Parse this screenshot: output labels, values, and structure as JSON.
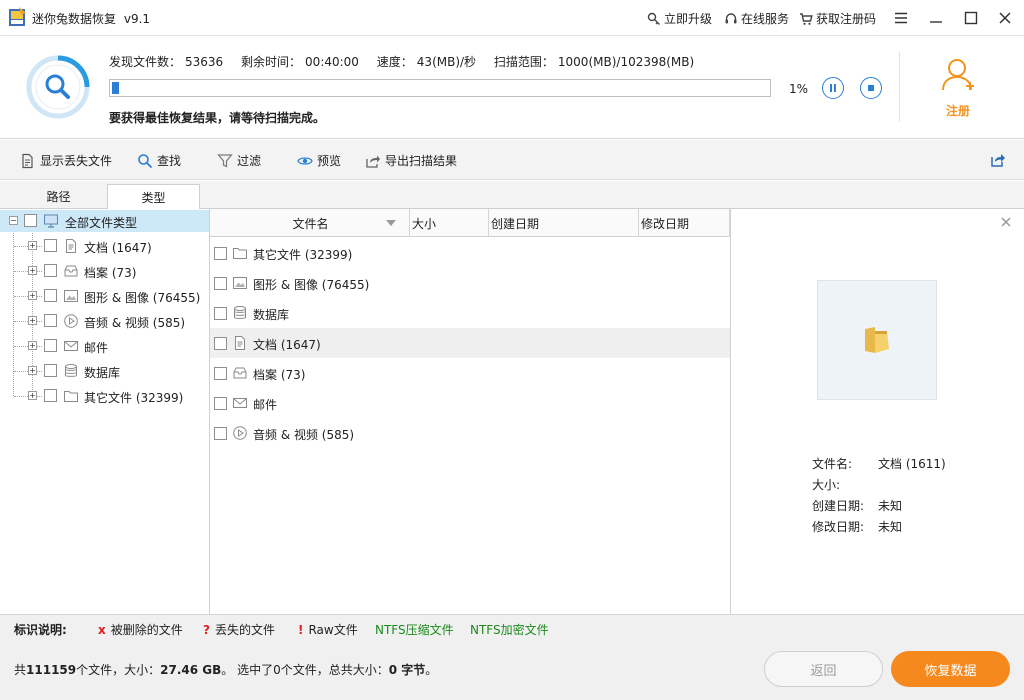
{
  "app": {
    "title": "迷你兔数据恢复",
    "version": "v9.1"
  },
  "titlebar": {
    "upgrade": "立即升级",
    "online_service": "在线服务",
    "get_code": "获取注册码"
  },
  "scan": {
    "found_label": "发现文件数：",
    "found_value": "53636",
    "remaining_label": "剩余时间：",
    "remaining_value": "00:40:00",
    "speed_label": "速度：",
    "speed_value": "43(MB)/秒",
    "range_label": "扫描范围：",
    "range_value": "1000(MB)/102398(MB)",
    "progress_percent": 1,
    "progress_text": "1%",
    "hint": "要获得最佳恢复结果，请等待扫描完成。",
    "register_label": "注册"
  },
  "toolbar": {
    "show_lost": "显示丢失文件",
    "find": "查找",
    "filter": "过滤",
    "preview": "预览",
    "export": "导出扫描结果"
  },
  "tabs": {
    "path": "路径",
    "type": "类型"
  },
  "tree": {
    "root": "全部文件类型",
    "items": [
      {
        "label": "文档 (1647)",
        "icon": "document-icon"
      },
      {
        "label": "档案 (73)",
        "icon": "archive-icon"
      },
      {
        "label": "图形 & 图像 (76455)",
        "icon": "image-icon"
      },
      {
        "label": "音频 & 视频 (585)",
        "icon": "media-icon"
      },
      {
        "label": "邮件",
        "icon": "mail-icon"
      },
      {
        "label": "数据库",
        "icon": "database-icon"
      },
      {
        "label": "其它文件 (32399)",
        "icon": "folder-icon"
      }
    ]
  },
  "list": {
    "columns": [
      "文件名",
      "大小",
      "创建日期",
      "修改日期"
    ],
    "rows": [
      {
        "name": "其它文件 (32399)",
        "icon": "folder-icon"
      },
      {
        "name": "图形 & 图像 (76455)",
        "icon": "image-icon"
      },
      {
        "name": "数据库",
        "icon": "database-icon"
      },
      {
        "name": "文档 (1647)",
        "icon": "document-icon"
      },
      {
        "name": "档案 (73)",
        "icon": "archive-icon"
      },
      {
        "name": "邮件",
        "icon": "mail-icon"
      },
      {
        "name": "音频 & 视频 (585)",
        "icon": "media-icon"
      }
    ]
  },
  "preview": {
    "filename_label": "文件名:",
    "filename_value": "文档 (1611)",
    "size_label": "大小:",
    "size_value": "",
    "created_label": "创建日期:",
    "created_value": "未知",
    "modified_label": "修改日期:",
    "modified_value": "未知"
  },
  "legend": {
    "title": "标识说明:",
    "deleted_mark": "x",
    "deleted": "被删除的文件",
    "lost_mark": "?",
    "lost": "丢失的文件",
    "raw_mark": "!",
    "raw": "Raw文件",
    "ntfs_compressed": "NTFS压缩文件",
    "ntfs_encrypted": "NTFS加密文件"
  },
  "status": {
    "p1": "共",
    "total_files": "111159",
    "p2": "个文件，大小：",
    "total_size": "27.46 GB",
    "p3": "。 选中了0个文件，总共大小：",
    "selected_size": "0 字节",
    "p4": "。",
    "back": "返回",
    "recover": "恢复数据"
  },
  "colors": {
    "accent": "#2a7fd5",
    "orange": "#f5891e",
    "red": "#e02020",
    "green": "#1b8a1b"
  }
}
